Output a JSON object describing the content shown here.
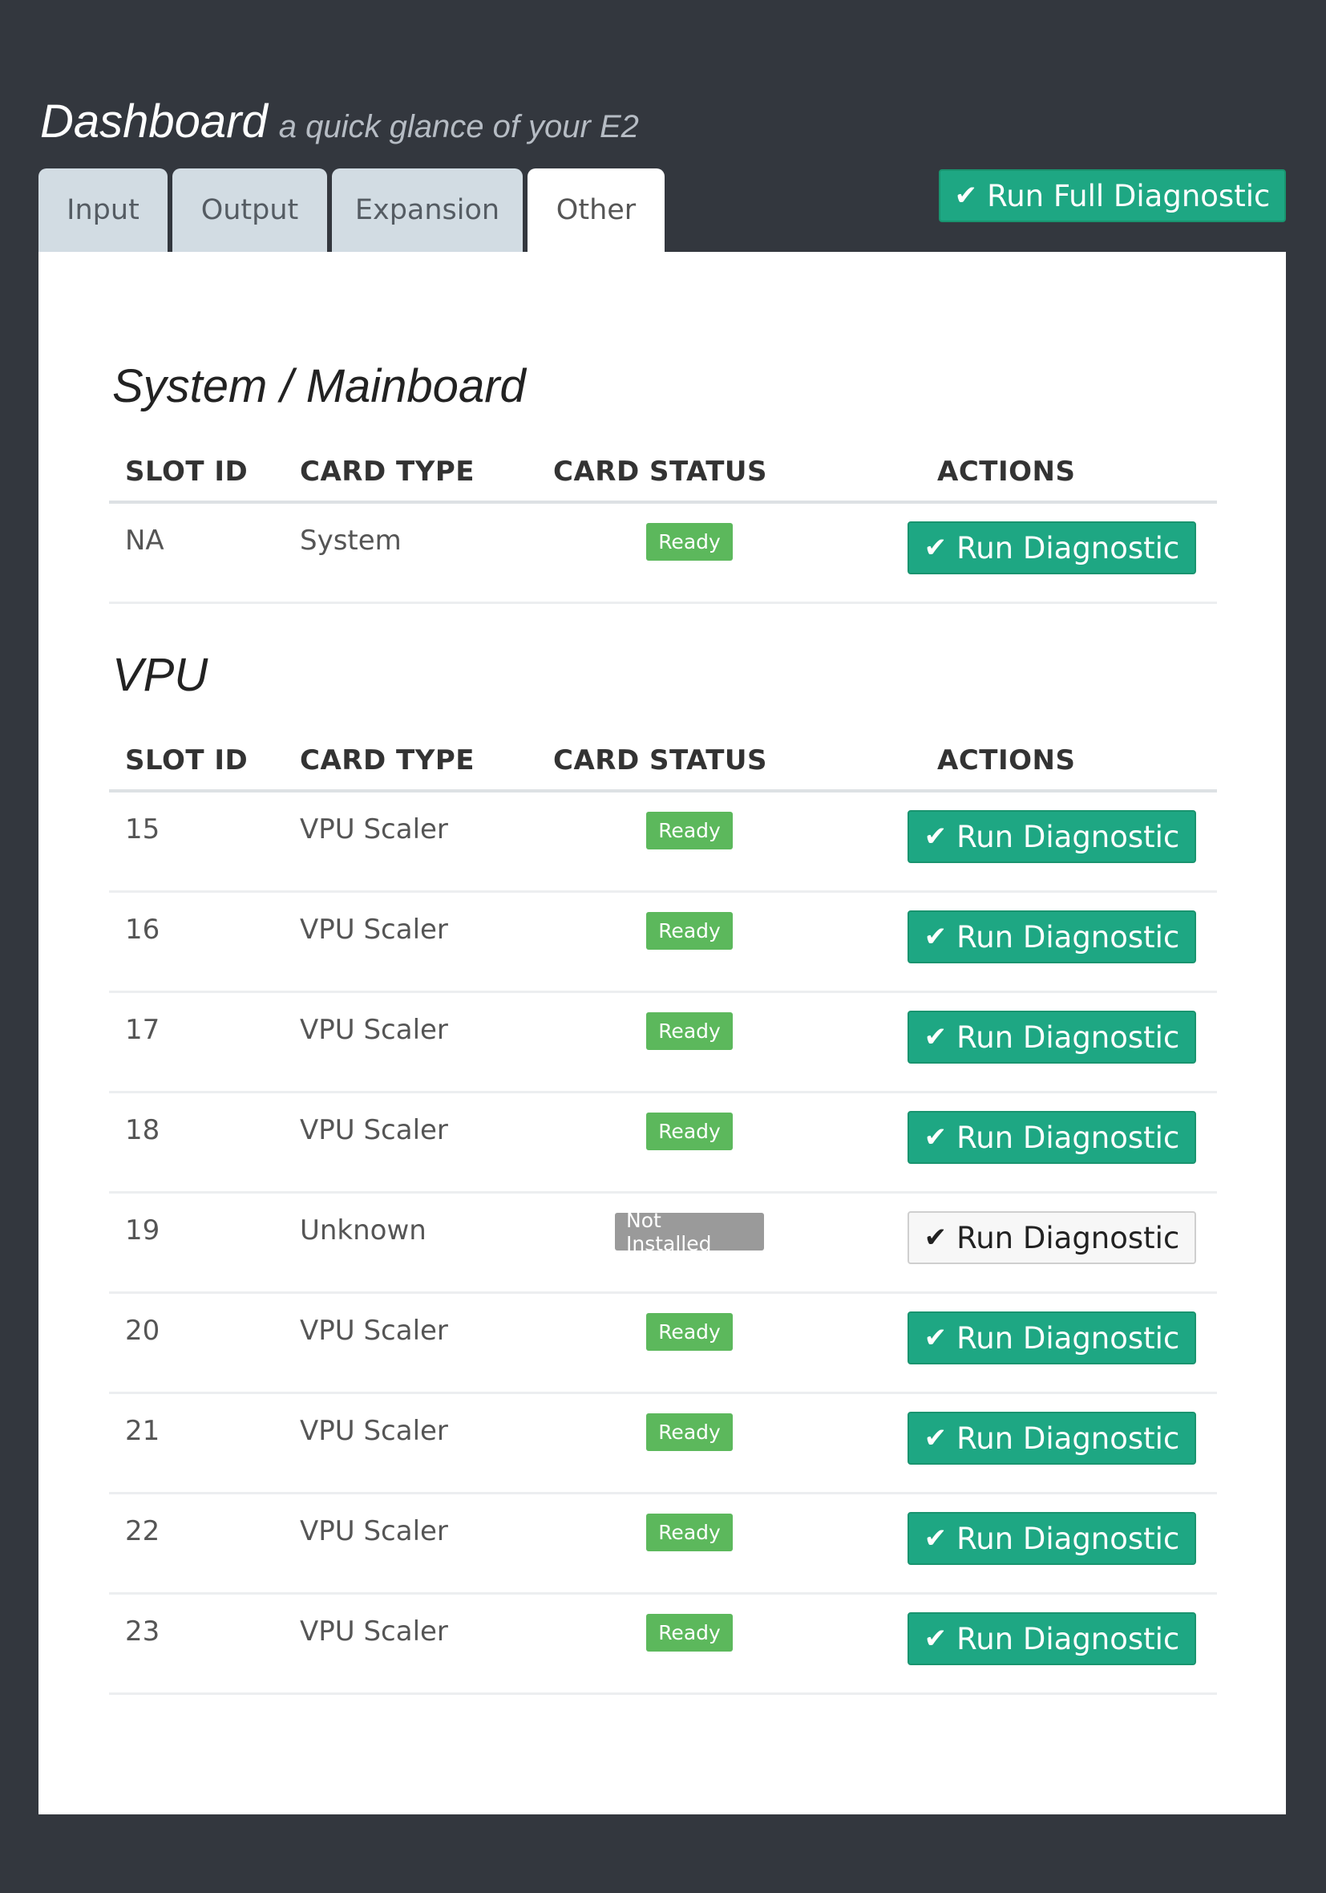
{
  "header": {
    "title": "Dashboard",
    "subtitle": "a quick glance of your E2"
  },
  "tabs": [
    {
      "label": "Input",
      "active": false
    },
    {
      "label": "Output",
      "active": false
    },
    {
      "label": "Expansion",
      "active": false
    },
    {
      "label": "Other",
      "active": true
    }
  ],
  "toolbar": {
    "run_full_label": "Run Full Diagnostic"
  },
  "columns": {
    "slot_id": "SLOT ID",
    "card_type": "CARD TYPE",
    "card_status": "CARD STATUS",
    "actions": "ACTIONS"
  },
  "sections": [
    {
      "title": "System / Mainboard",
      "rows": [
        {
          "slot": "NA",
          "type": "System",
          "status": "Ready",
          "action": "Run Diagnostic"
        }
      ]
    },
    {
      "title": "VPU",
      "rows": [
        {
          "slot": "15",
          "type": "VPU Scaler",
          "status": "Ready",
          "action": "Run Diagnostic"
        },
        {
          "slot": "16",
          "type": "VPU Scaler",
          "status": "Ready",
          "action": "Run Diagnostic"
        },
        {
          "slot": "17",
          "type": "VPU Scaler",
          "status": "Ready",
          "action": "Run Diagnostic"
        },
        {
          "slot": "18",
          "type": "VPU Scaler",
          "status": "Ready",
          "action": "Run Diagnostic"
        },
        {
          "slot": "19",
          "type": "Unknown",
          "status": "Not Installed",
          "action": "Run Diagnostic"
        },
        {
          "slot": "20",
          "type": "VPU Scaler",
          "status": "Ready",
          "action": "Run Diagnostic"
        },
        {
          "slot": "21",
          "type": "VPU Scaler",
          "status": "Ready",
          "action": "Run Diagnostic"
        },
        {
          "slot": "22",
          "type": "VPU Scaler",
          "status": "Ready",
          "action": "Run Diagnostic"
        },
        {
          "slot": "23",
          "type": "VPU Scaler",
          "status": "Ready",
          "action": "Run Diagnostic"
        }
      ]
    }
  ],
  "colors": {
    "background": "#33373e",
    "accent": "#1ea783",
    "ready": "#5cb85c",
    "not_installed": "#9a9a9a"
  },
  "icons": {
    "check": "check-icon"
  }
}
